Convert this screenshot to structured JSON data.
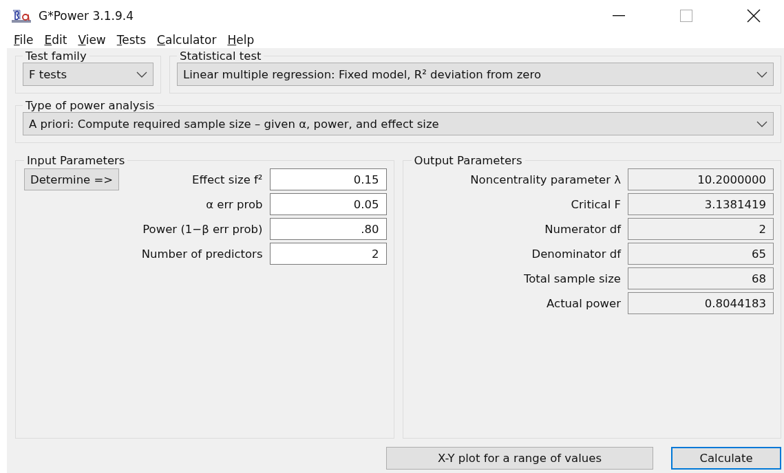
{
  "window": {
    "title": "G*Power 3.1.9.4"
  },
  "menu": [
    "File",
    "Edit",
    "View",
    "Tests",
    "Calculator",
    "Help"
  ],
  "test_family": {
    "label": "Test family",
    "value": "F tests"
  },
  "statistical_test": {
    "label": "Statistical test",
    "value": "Linear multiple regression: Fixed model, R² deviation from zero"
  },
  "power_analysis": {
    "label": "Type of power analysis",
    "value": "A priori: Compute required sample size – given α, power, and effect size"
  },
  "input_parameters": {
    "label": "Input Parameters",
    "determine_button": "Determine =>",
    "fields": [
      {
        "label": "Effect size f²",
        "value": "0.15"
      },
      {
        "label": "α err prob",
        "value": "0.05"
      },
      {
        "label": "Power (1−β err prob)",
        "value": ".80"
      },
      {
        "label": "Number of predictors",
        "value": "2"
      }
    ]
  },
  "output_parameters": {
    "label": "Output Parameters",
    "fields": [
      {
        "label": "Noncentrality parameter λ",
        "value": "10.2000000"
      },
      {
        "label": "Critical F",
        "value": "3.1381419"
      },
      {
        "label": "Numerator df",
        "value": "2"
      },
      {
        "label": "Denominator df",
        "value": "65"
      },
      {
        "label": "Total sample size",
        "value": "68"
      },
      {
        "label": "Actual power",
        "value": "0.8044183"
      }
    ]
  },
  "buttons": [
    {
      "label": "X-Y plot for a range of values",
      "focused": false
    },
    {
      "label": "Calculate",
      "focused": true
    }
  ]
}
